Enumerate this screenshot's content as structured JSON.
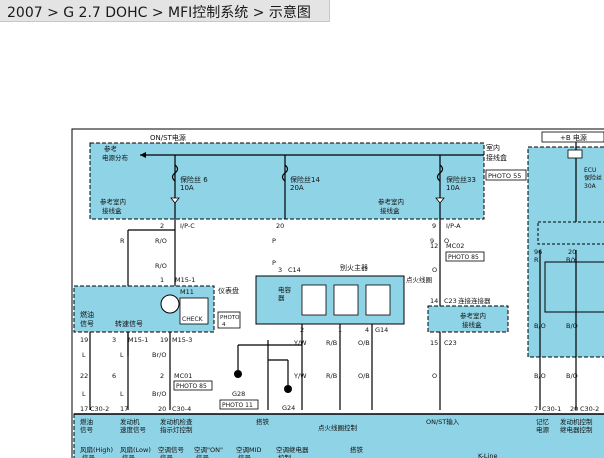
{
  "breadcrumb": "2007 > G 2.7 DOHC > MFI控制系统 > 示意图",
  "colors": {
    "blue_box": "#8fd3e6",
    "relay_box": "#8fd3e6",
    "line": "#000000"
  },
  "power": {
    "on_st": "ON/ST电源",
    "b_plus": "+B 电源",
    "ref_power_dist": "参考\n电源分布",
    "indoor_junction": "室内\n接线盒",
    "photo_55": "PHOTO 55"
  },
  "fuses": {
    "f6": "保险丝 6\n10A",
    "f14": "保险丝14\n20A",
    "f33": "保险丝33\n10A",
    "ecu_fuse": "ECU\n保险丝\n30A"
  },
  "refs": {
    "ref_indoor_left": "参考室内\n接线盒",
    "ref_indoor_right": "参考室内\n接线盒",
    "ref_indoor_connector": "参考室内\n接线盒"
  },
  "pins": {
    "i_p_c": "I/P-C",
    "i_p_a": "I/P-A",
    "mc02": "MC02",
    "m15_1": "M15-1",
    "m15_3": "M15-3",
    "mc01": "MC01",
    "c14": "C14",
    "c23a": "C23",
    "c23b": "C23",
    "c30_2": "C30-2",
    "c30_4": "C30-4",
    "c30_5": "C30-5",
    "c30_1": "C30-1",
    "c23_left": "C23",
    "c30_2b": "C30-2",
    "g28": "G28",
    "g24": "G24",
    "n2": "2",
    "n20": "20",
    "n9": "9",
    "n12": "12",
    "n3": "3",
    "n14": "14",
    "n15": "15",
    "n19": "19",
    "n22": "22",
    "n17": "17",
    "n5": "5",
    "n7": "7",
    "n1": "1",
    "n4": "4"
  },
  "wires": {
    "r": "R",
    "r_o": "R/O",
    "p": "P",
    "o": "O",
    "l": "L",
    "br_o": "Br/O",
    "b_o": "B/O",
    "y_w": "Y/W",
    "r_b": "R/B",
    "o_b": "O/B"
  },
  "components": {
    "m11": "M11",
    "instrument": "仪表盘",
    "check": "CHECK",
    "oil_pressure": "燃油\n信号",
    "speed_signal": "转速信号",
    "photo_4": "PHOTO\n4",
    "photo_85a": "PHOTO 85",
    "photo_85b": "PHOTO 85",
    "photo_11": "PHOTO 11",
    "ignition_main": "别火主器",
    "capacitor": "电容\n器",
    "coil": "点火线圈",
    "connector": "连接连接器",
    "ground": "搭铁"
  },
  "bottom": {
    "rows": [
      "燃油\n信号",
      "发动机\n速度信号",
      "发动机检查\n指示灯控制",
      "搭铁",
      "点火线圈控制",
      "ON/ST输入",
      "记忆\n电源",
      "发动机控制\n继电器控制"
    ],
    "row2": [
      "风扇(High)\n信号",
      "风扇(Low)\n信号",
      "空调信号\n信号",
      "空调\"ON\"\n信号",
      "空调MID\n信号",
      "空调继电器\n控制",
      "搭铁",
      "K-Line"
    ]
  }
}
